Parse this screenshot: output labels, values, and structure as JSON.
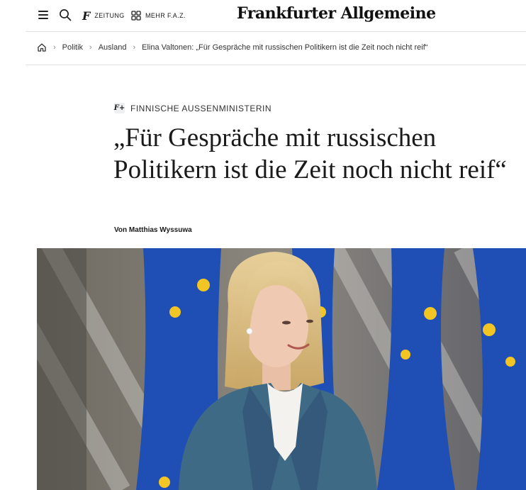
{
  "header": {
    "zeitung_label": "ZEITUNG",
    "mehr_label": "MEHR F.A.Z.",
    "logo_text": "Frankfurter Allgemeine"
  },
  "breadcrumb": {
    "items": [
      "Politik",
      "Ausland",
      "Elina Valtonen: „Für Gespräche mit russischen Politikern ist die Zeit noch nicht reif“"
    ]
  },
  "article": {
    "kicker_badge": "F+",
    "kicker": "FINNISCHE AUSSENMINISTERIN",
    "headline": "„Für Gespräche mit russischen Politikern ist die Zeit noch nicht reif“",
    "author": "Von Matthias Wyssuwa"
  },
  "icons": {
    "menu": "hamburger-menu-icon",
    "search": "search-icon",
    "zeitung": "faz-f-icon",
    "mehr": "grid-icon",
    "home": "home-icon"
  },
  "colors": {
    "eu_blue": "#1f4fb4",
    "eu_star": "#f3c524",
    "jacket": "#3f6a86",
    "text": "#1a1a1a"
  }
}
